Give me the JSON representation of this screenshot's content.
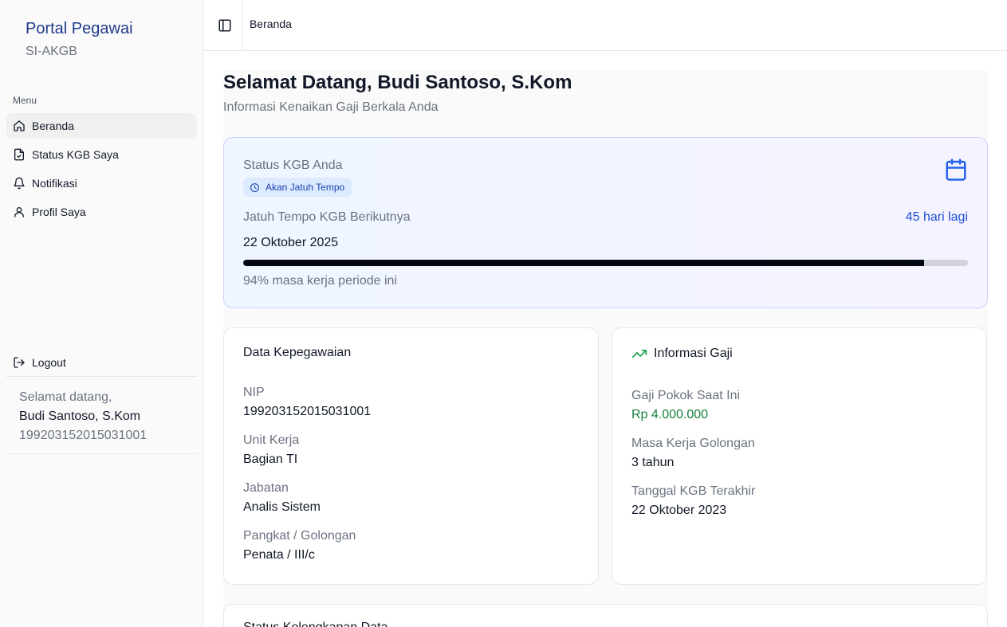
{
  "sidebar": {
    "brand_title": "Portal Pegawai",
    "brand_subtitle": "SI-AKGB",
    "menu_label": "Menu",
    "items": [
      {
        "label": "Beranda",
        "icon": "home-icon",
        "active": true
      },
      {
        "label": "Status KGB Saya",
        "icon": "file-check-icon",
        "active": false
      },
      {
        "label": "Notifikasi",
        "icon": "bell-icon",
        "active": false
      },
      {
        "label": "Profil Saya",
        "icon": "user-icon",
        "active": false
      }
    ],
    "logout_label": "Logout",
    "user": {
      "greeting": "Selamat datang,",
      "name": "Budi Santoso, S.Kom",
      "nip": "199203152015031001"
    }
  },
  "header": {
    "toggle_icon": "sidebar-toggle-icon",
    "breadcrumb": "Beranda"
  },
  "main": {
    "title": "Selamat Datang, Budi Santoso, S.Kom",
    "subtitle": "Informasi Kenaikan Gaji Berkala Anda",
    "status_card": {
      "label": "Status KGB Anda",
      "badge": "Akan Jatuh Tempo",
      "due_label": "Jatuh Tempo KGB Berikutnya",
      "due_days": "45 hari lagi",
      "due_date": "22 Oktober 2025",
      "progress_percent": 94,
      "progress_text": "94% masa kerja periode ini",
      "icon": "calendar-icon"
    },
    "employment_card": {
      "title": "Data Kepegawaian",
      "fields": [
        {
          "label": "NIP",
          "value": "199203152015031001"
        },
        {
          "label": "Unit Kerja",
          "value": "Bagian TI"
        },
        {
          "label": "Jabatan",
          "value": "Analis Sistem"
        },
        {
          "label": "Pangkat / Golongan",
          "value": "Penata / III/c"
        }
      ]
    },
    "salary_card": {
      "title": "Informasi Gaji",
      "icon": "trending-up-icon",
      "fields": [
        {
          "label": "Gaji Pokok Saat Ini",
          "value": "Rp 4.000.000"
        },
        {
          "label": "Masa Kerja Golongan",
          "value": "3 tahun"
        },
        {
          "label": "Tanggal KGB Terakhir",
          "value": "22 Oktober 2023"
        }
      ]
    },
    "bottom_card": {
      "title": "Status Kelengkapan Data"
    }
  },
  "colors": {
    "brand": "#1e3a8a",
    "accent": "#1d4ed8",
    "salary_green": "#15803d",
    "trend_green": "#16a34a"
  }
}
